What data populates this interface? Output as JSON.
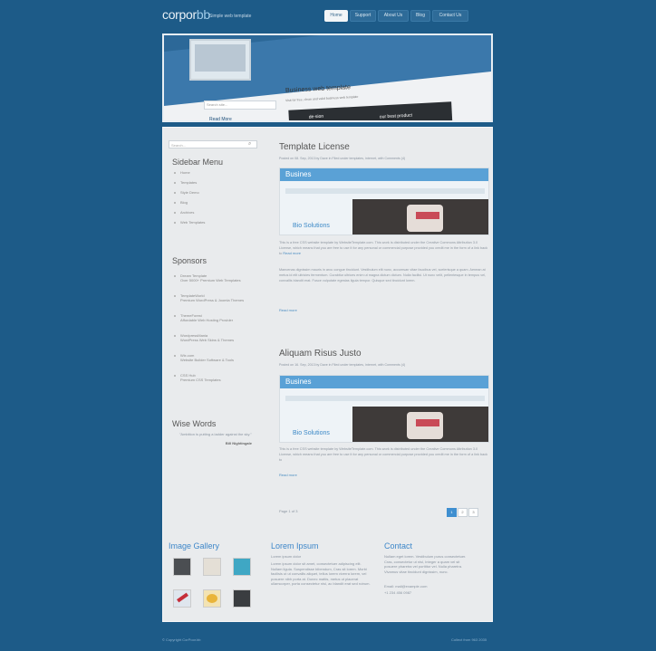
{
  "header": {
    "logo_main": "corpor",
    "logo_accent": "bb",
    "tagline": "Simple web template",
    "nav": [
      "Home",
      "Support",
      "About Us",
      "Blog",
      "Contact Us"
    ],
    "active_nav": "Home"
  },
  "banner": {
    "title": "Business web template",
    "subtitle": "Visit for free, clean and valid business web template",
    "search_placeholder": "Search site...",
    "dark_text1": "de-sion",
    "dark_text2": "our best product",
    "link": "Read More"
  },
  "sidebar": {
    "search_placeholder": "Search...",
    "menu_title": "Sidebar Menu",
    "menu_items": [
      "Home",
      "Templates",
      "Style Demo",
      "Blog",
      "Archives",
      "Web Templates"
    ],
    "sponsors_title": "Sponsors",
    "sponsors": [
      "Dream Template\nOver 5000+ Premium Web Templates",
      "TemplateWorld\nPremium WordPress & Joomla Themes",
      "ThemeForest\nAffordable Web Hosting Provider",
      "WordpressMania\nWordPress Web Skins & Themes",
      "Wix.com\nWebsite Builder Software & Tools",
      "CSS Hub\nPremium CSS Templates"
    ],
    "wise_title": "Wise Words",
    "wise_quote": "\"Ambition is putting a ladder against the sky.\"",
    "wise_author": "Bill Nightingale"
  },
  "posts": [
    {
      "title": "Template License",
      "meta": "Posted on 08. Sep, 2013 by Dave in Filed under templates, internet, with Comments (4)",
      "image_brand": "Busines",
      "image_caption": "Bio Solutions",
      "p1": "This is a free CSS website template by WebsiteTemplate.com. This work is distributed under the Creative Commons Attribution 3.0 License, which means that you are free to use it for any personal or commercial purpose provided you credit me in the form of a link back to",
      "link": "Read more",
      "p2": "Maecenas dignissim mauris in arcu congue tincidunt. Vestibulum elit nunc, accumsan vitae faucibus vel, scelerisque a quam. Aenean at metus id elit ultricies fermentum. Curabitur ultrices enim ut magna dictum dictum. Nulla facilisi. Ut nunc velit, pellentesque in tempus vel, convallis blandit erat. Fusce vulputate egestas ligula tempor. Quisque sed tincidunt lorem."
    },
    {
      "title": "Aliquam Risus Justo",
      "meta": "Posted on 16. Sep, 2013 by Dave in Filed under templates, internet, with Comments (4)",
      "image_brand": "Busines",
      "image_caption": "Bio Solutions",
      "p1": "This is a free CSS website template by WebsiteTemplate.com. This work is distributed under the Creative Commons Attribution 3.0 License, which means that you are free to use it for any personal or commercial purpose provided you credit me in the form of a link back to",
      "link": "Read more",
      "p2": ""
    }
  ],
  "pagination": {
    "label": "Page 1 of 3",
    "pages": [
      "1",
      "2",
      "3"
    ],
    "active": "1"
  },
  "footer": {
    "gallery_title": "Image Gallery",
    "lorem_title": "Lorem Ipsum",
    "lorem_sub": "Lorem ipsum dolor",
    "lorem_text": "Lorem ipsum dolor sit amet, consectetuer adipiscing elit. Nullam ligula. Suspendisse bibendum, Cras sit lorem. Morbi facilisis ut ut convallis aliquet, tellus lorem viverra lorem, vel posuere nibh porta at. Donec mattis, metus ut placerat ullamcorper, porta consectetur nisi, ac blandit erat sed rutrum.",
    "contact_title": "Contact",
    "contact_text": "Nullam eget lorem. Vestibulum purus consectetuer. Cras, consectetur ut nisl, Integer a quam vel sit posuere pharetra vel porttitor vel. Nulla pharetra. Vivamus vitae tincidunt dignissim, nunc.",
    "contact_extra": "Email: mail@example.com",
    "contact_phone": "+1 234 456 0987",
    "copyright": "© Copyright CorPoor.bb",
    "credit": "Collect from 963 2035"
  }
}
